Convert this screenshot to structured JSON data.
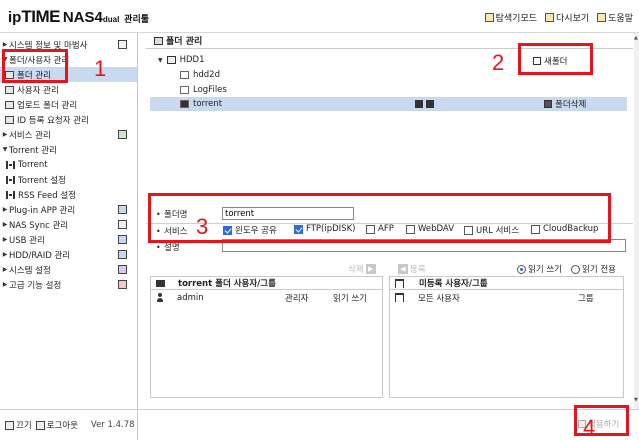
{
  "header": {
    "logo_ip": "ip",
    "logo_time": "TIME",
    "logo_model": "NAS4",
    "logo_dual": "dual",
    "logo_admin": "관리툴",
    "links": [
      {
        "label": "탐색기모드",
        "icon": "explorer-icon"
      },
      {
        "label": "다시보기",
        "icon": "reload-icon"
      },
      {
        "label": "도움말",
        "icon": "help-icon"
      }
    ]
  },
  "sidebar": {
    "items": [
      {
        "label": "시스템 정보 및 마법사",
        "expanded": false
      },
      {
        "label": "폴더/사용자 관리",
        "expanded": true
      },
      {
        "label": "폴더 관리",
        "selected": true
      },
      {
        "label": "사용자 관리"
      },
      {
        "label": "업로드 폴더 관리"
      },
      {
        "label": "ID 등록 요청자 관리"
      },
      {
        "label": "서비스 관리",
        "expanded": false
      },
      {
        "label": "Torrent 관리",
        "expanded": true
      },
      {
        "label": "Torrent"
      },
      {
        "label": "Torrent 설정"
      },
      {
        "label": "RSS Feed 설정"
      },
      {
        "label": "Plug-in APP 관리",
        "expanded": false
      },
      {
        "label": "NAS Sync 관리",
        "expanded": false
      },
      {
        "label": "USB 관리",
        "expanded": false
      },
      {
        "label": "HDD/RAID 관리",
        "expanded": false
      },
      {
        "label": "시스템 설정",
        "expanded": false
      },
      {
        "label": "고급 기능 설정",
        "expanded": false
      }
    ],
    "footer": {
      "power_label": "끄기",
      "logout_label": "로그아웃",
      "version": "Ver 1.4.78"
    }
  },
  "main": {
    "panel_title": "폴더 관리",
    "tree": {
      "root": "HDD1",
      "folders": [
        "hdd2d",
        "LogFiles",
        "torrent"
      ],
      "selected": "torrent"
    },
    "new_folder_label": "새폴더",
    "delete_folder_label": "폴더삭제",
    "form": {
      "name_label": "폴더명",
      "name_value": "torrent",
      "service_label": "서비스",
      "desc_label": "설명",
      "desc_value": "",
      "services": [
        {
          "label": "윈도우 공유",
          "checked": true
        },
        {
          "label": "FTP(ipDISK)",
          "checked": true
        },
        {
          "label": "AFP",
          "checked": false
        },
        {
          "label": "WebDAV",
          "checked": false
        },
        {
          "label": "URL 서비스",
          "checked": false
        },
        {
          "label": "CloudBackup",
          "checked": false
        }
      ]
    },
    "permissions": {
      "delete_label": "삭제",
      "add_label": "등록",
      "read_write_label": "읽기 쓰기",
      "read_only_label": "읽기 전용",
      "read_write_selected": true,
      "left_title": "torrent 폴더 사용자/그룹",
      "left_rows": [
        {
          "name": "admin",
          "role": "관리자",
          "perm": "읽기 쓰기"
        }
      ],
      "right_title": "미등록 사용자/그룹",
      "right_rows": [
        {
          "name": "모든 사용자",
          "role": "그룹"
        }
      ]
    },
    "apply_label": "적용하기"
  },
  "annotations": {
    "n1": "1",
    "n2": "2",
    "n3": "3",
    "n4": "4",
    "color": "#e8141b"
  }
}
